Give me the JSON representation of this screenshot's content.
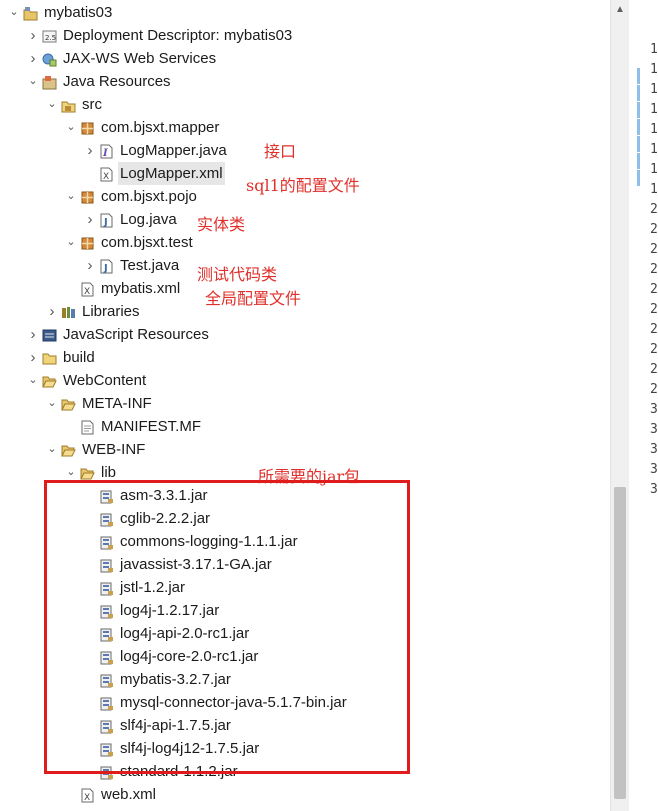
{
  "tree": [
    {
      "label": "mybatis03",
      "depth": 0,
      "arrow": "open",
      "icon": "project-icon"
    },
    {
      "label": "Deployment Descriptor: mybatis03",
      "depth": 1,
      "arrow": "closed",
      "icon": "descriptor-icon"
    },
    {
      "label": "JAX-WS Web Services",
      "depth": 1,
      "arrow": "closed",
      "icon": "webservice-icon"
    },
    {
      "label": "Java Resources",
      "depth": 1,
      "arrow": "open",
      "icon": "java-resources-icon"
    },
    {
      "label": "src",
      "depth": 2,
      "arrow": "open",
      "icon": "source-folder-icon"
    },
    {
      "label": "com.bjsxt.mapper",
      "depth": 3,
      "arrow": "open",
      "icon": "package-icon"
    },
    {
      "label": "LogMapper.java",
      "depth": 4,
      "arrow": "closed",
      "icon": "java-interface-icon"
    },
    {
      "label": "LogMapper.xml",
      "depth": 4,
      "arrow": "none",
      "icon": "xml-file-icon",
      "selected": true
    },
    {
      "label": "com.bjsxt.pojo",
      "depth": 3,
      "arrow": "open",
      "icon": "package-icon"
    },
    {
      "label": "Log.java",
      "depth": 4,
      "arrow": "closed",
      "icon": "java-file-icon"
    },
    {
      "label": "com.bjsxt.test",
      "depth": 3,
      "arrow": "open",
      "icon": "package-icon"
    },
    {
      "label": "Test.java",
      "depth": 4,
      "arrow": "closed",
      "icon": "java-file-icon"
    },
    {
      "label": "mybatis.xml",
      "depth": 3,
      "arrow": "none",
      "icon": "xml-file-icon"
    },
    {
      "label": "Libraries",
      "depth": 2,
      "arrow": "closed",
      "icon": "library-icon"
    },
    {
      "label": "JavaScript Resources",
      "depth": 1,
      "arrow": "closed",
      "icon": "js-resources-icon"
    },
    {
      "label": "build",
      "depth": 1,
      "arrow": "closed",
      "icon": "folder-icon"
    },
    {
      "label": "WebContent",
      "depth": 1,
      "arrow": "open",
      "icon": "folder-open-icon"
    },
    {
      "label": "META-INF",
      "depth": 2,
      "arrow": "open",
      "icon": "folder-open-icon"
    },
    {
      "label": "MANIFEST.MF",
      "depth": 3,
      "arrow": "none",
      "icon": "text-file-icon"
    },
    {
      "label": "WEB-INF",
      "depth": 2,
      "arrow": "open",
      "icon": "folder-open-icon"
    },
    {
      "label": "lib",
      "depth": 3,
      "arrow": "open",
      "icon": "folder-open-icon"
    },
    {
      "label": "asm-3.3.1.jar",
      "depth": 4,
      "arrow": "none",
      "icon": "jar-icon"
    },
    {
      "label": "cglib-2.2.2.jar",
      "depth": 4,
      "arrow": "none",
      "icon": "jar-icon"
    },
    {
      "label": "commons-logging-1.1.1.jar",
      "depth": 4,
      "arrow": "none",
      "icon": "jar-icon"
    },
    {
      "label": "javassist-3.17.1-GA.jar",
      "depth": 4,
      "arrow": "none",
      "icon": "jar-icon"
    },
    {
      "label": "jstl-1.2.jar",
      "depth": 4,
      "arrow": "none",
      "icon": "jar-icon"
    },
    {
      "label": "log4j-1.2.17.jar",
      "depth": 4,
      "arrow": "none",
      "icon": "jar-icon"
    },
    {
      "label": "log4j-api-2.0-rc1.jar",
      "depth": 4,
      "arrow": "none",
      "icon": "jar-icon"
    },
    {
      "label": "log4j-core-2.0-rc1.jar",
      "depth": 4,
      "arrow": "none",
      "icon": "jar-icon"
    },
    {
      "label": "mybatis-3.2.7.jar",
      "depth": 4,
      "arrow": "none",
      "icon": "jar-icon"
    },
    {
      "label": "mysql-connector-java-5.1.7-bin.jar",
      "depth": 4,
      "arrow": "none",
      "icon": "jar-icon"
    },
    {
      "label": "slf4j-api-1.7.5.jar",
      "depth": 4,
      "arrow": "none",
      "icon": "jar-icon"
    },
    {
      "label": "slf4j-log4j12-1.7.5.jar",
      "depth": 4,
      "arrow": "none",
      "icon": "jar-icon"
    },
    {
      "label": "standard-1.1.2.jar",
      "depth": 4,
      "arrow": "none",
      "icon": "jar-icon"
    },
    {
      "label": "web.xml",
      "depth": 3,
      "arrow": "none",
      "icon": "xml-file-icon"
    }
  ],
  "annotations": {
    "interface": "接口",
    "sql_config": "sql1的配置文件",
    "entity": "实体类",
    "test_code": "测试代码类",
    "global_config": "全局配置文件",
    "required_jars": "所需要的jar包"
  },
  "gutter_numbers": [
    "1",
    "1",
    "1",
    "1",
    "1",
    "1",
    "1",
    "1",
    "2",
    "2",
    "2",
    "2",
    "2",
    "2",
    "2",
    "2",
    "2",
    "2",
    "3",
    "3",
    "3",
    "3",
    "3"
  ],
  "colors": {
    "annotation": "#e0302b",
    "highlight_box": "#e01b1b",
    "selection": "#e6e6e6"
  }
}
